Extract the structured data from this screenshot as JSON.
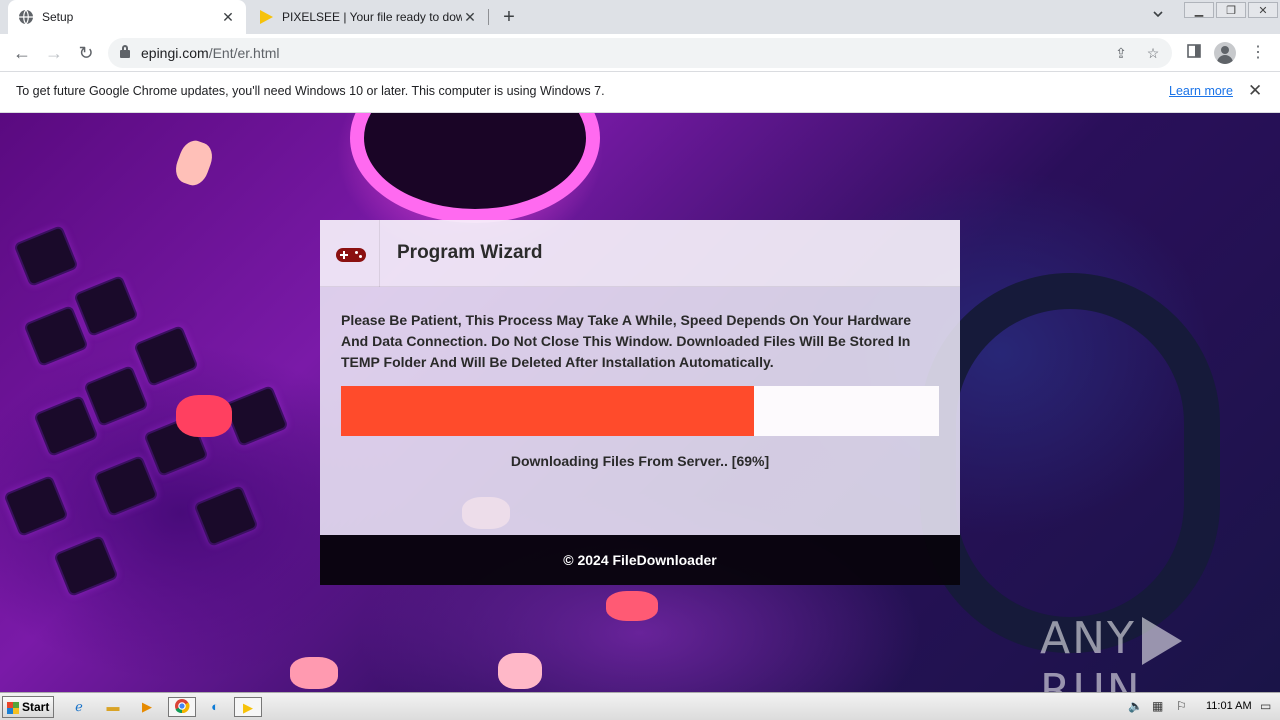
{
  "browser": {
    "tabs": [
      {
        "title": "Setup",
        "icon": "globe-icon",
        "active": true
      },
      {
        "title": "PIXELSEE | Your file ready to download",
        "icon": "play-triangle-icon",
        "active": false
      }
    ],
    "new_tab_glyph": "+",
    "url_host": "epingi.com",
    "url_path": "/Ent/er.html"
  },
  "infobar": {
    "message": "To get future Google Chrome updates, you'll need Windows 10 or later. This computer is using Windows 7.",
    "link": "Learn more"
  },
  "wizard": {
    "title": "Program Wizard",
    "message": "Please Be Patient, This Process May Take A While, Speed Depends On Your Hardware And Data Connection. Do Not Close This Window. Downloaded Files Will Be Stored In TEMP Folder And Will Be Deleted After Installation Automatically.",
    "progress_percent": 69,
    "progress_color": "#ff4b2b",
    "status": "Downloading Files From Server.. [69%]",
    "footer": "© 2024 FileDownloader"
  },
  "watermark": {
    "left": "ANY",
    "right": "RUN"
  },
  "taskbar": {
    "start_label": "Start",
    "clock": "11:01 AM"
  }
}
